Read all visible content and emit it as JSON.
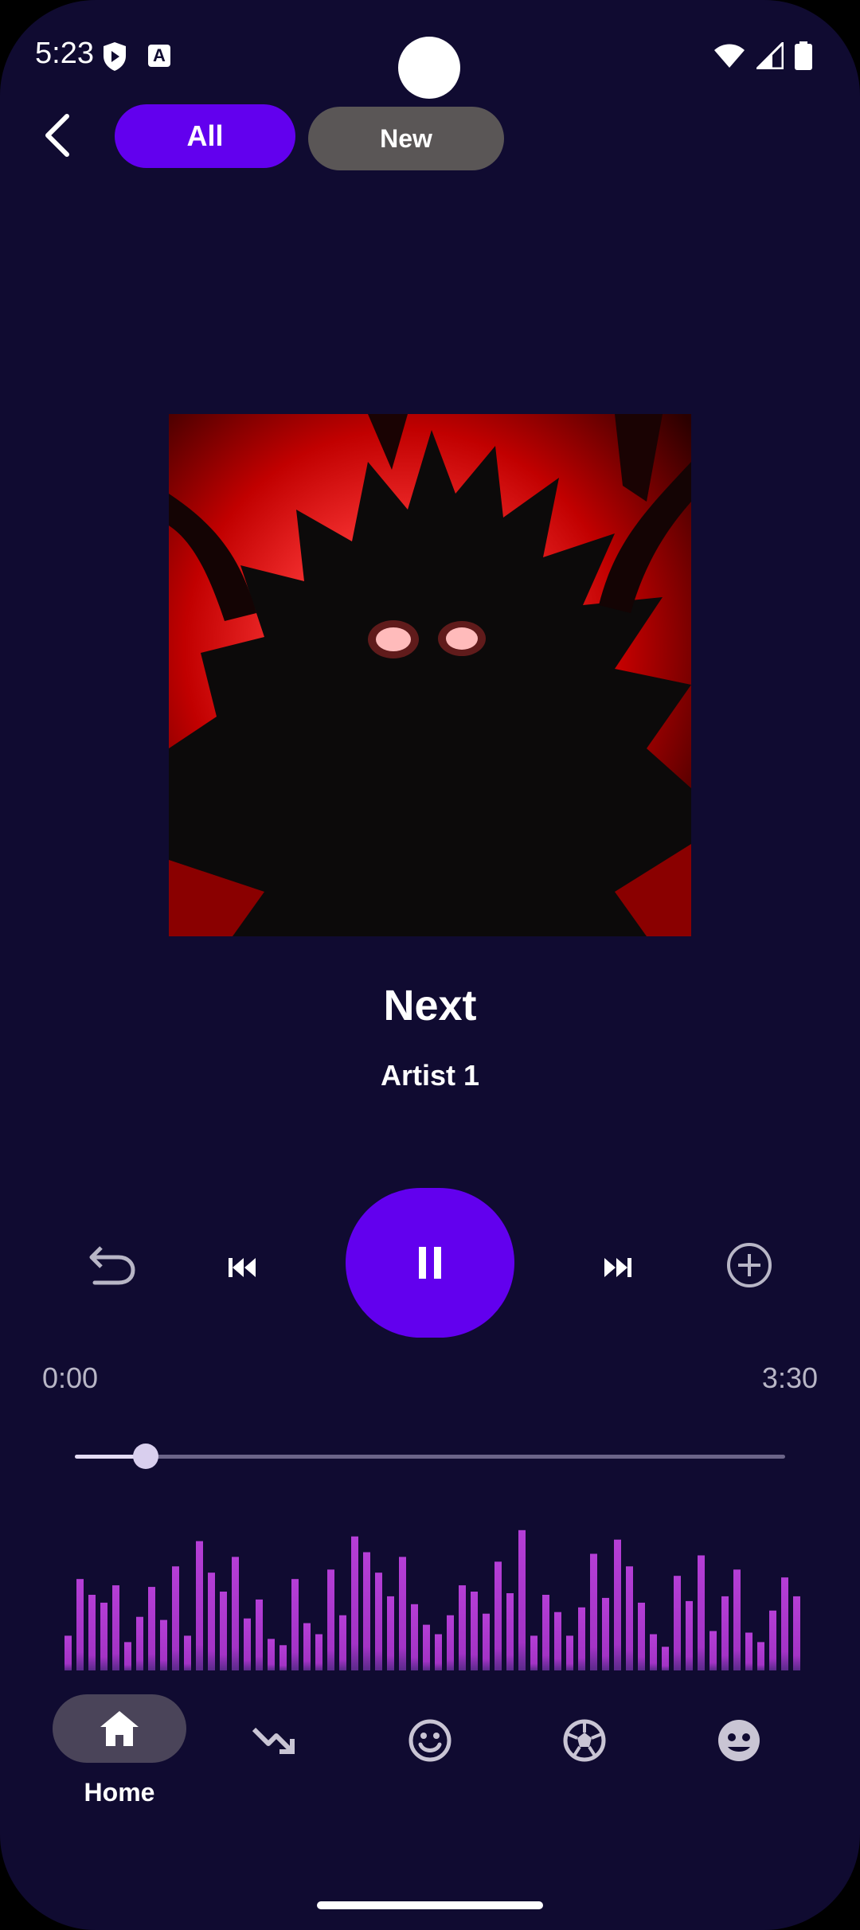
{
  "status_bar": {
    "time": "5:23"
  },
  "top_bar": {
    "chips": [
      {
        "label": "All",
        "selected": true
      },
      {
        "label": "New",
        "selected": false
      }
    ]
  },
  "now_playing": {
    "title": "Next",
    "artist": "Artist 1",
    "elapsed": "0:00",
    "duration": "3:30",
    "progress_fraction": 0.1,
    "state": "playing"
  },
  "visualizer": {
    "levels": [
      0.22,
      0.58,
      0.48,
      0.43,
      0.54,
      0.18,
      0.34,
      0.53,
      0.32,
      0.66,
      0.22,
      0.82,
      0.62,
      0.5,
      0.72,
      0.33,
      0.45,
      0.2,
      0.16,
      0.58,
      0.3,
      0.23,
      0.64,
      0.35,
      0.85,
      0.75,
      0.62,
      0.47,
      0.72,
      0.42,
      0.29,
      0.23,
      0.35,
      0.54,
      0.5,
      0.36,
      0.69,
      0.49,
      0.89,
      0.22,
      0.48,
      0.37,
      0.22,
      0.4,
      0.74,
      0.46,
      0.83,
      0.66,
      0.43,
      0.23,
      0.15,
      0.6,
      0.44,
      0.73,
      0.25,
      0.47,
      0.64,
      0.24,
      0.18,
      0.38,
      0.59,
      0.47
    ]
  },
  "bottom_nav": {
    "items": [
      {
        "label": "Home",
        "icon": "home-icon",
        "selected": true
      },
      {
        "label": "",
        "icon": "trending-down-icon",
        "selected": false
      },
      {
        "label": "",
        "icon": "smile-icon",
        "selected": false
      },
      {
        "label": "",
        "icon": "soccer-ball-icon",
        "selected": false
      },
      {
        "label": "",
        "icon": "palette-icon",
        "selected": false
      }
    ]
  },
  "colors": {
    "background": "#100b31",
    "accent": "#6200ee",
    "chip_inactive": "#5a5656",
    "visualizer_bar": "#b53ed6"
  }
}
